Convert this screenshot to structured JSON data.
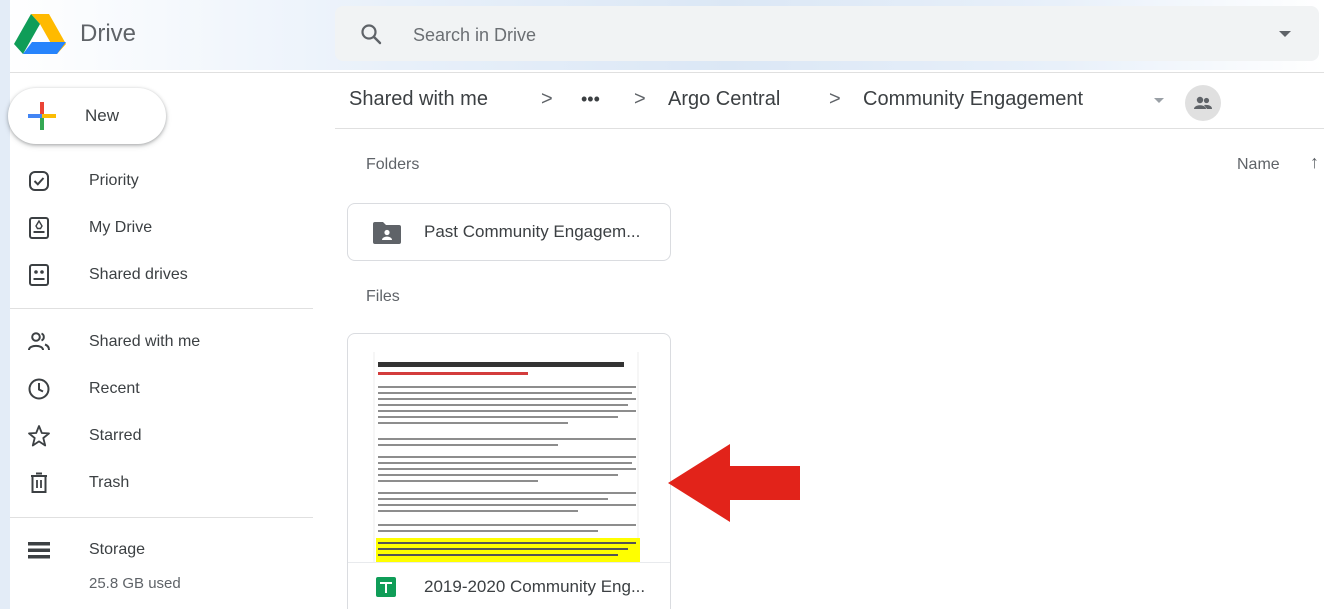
{
  "app": {
    "title": "Drive"
  },
  "search": {
    "placeholder": "Search in Drive",
    "icon": "search-icon"
  },
  "sidebar": {
    "new_label": "New",
    "items": [
      {
        "label": "Priority",
        "icon": "priority-check-icon"
      },
      {
        "label": "My Drive",
        "icon": "my-drive-icon"
      },
      {
        "label": "Shared drives",
        "icon": "shared-drives-icon"
      },
      {
        "label": "Shared with me",
        "icon": "people-icon"
      },
      {
        "label": "Recent",
        "icon": "clock-icon"
      },
      {
        "label": "Starred",
        "icon": "star-icon"
      },
      {
        "label": "Trash",
        "icon": "trash-icon"
      }
    ],
    "storage": {
      "label": "Storage",
      "used": "25.8 GB used",
      "icon": "storage-icon"
    }
  },
  "breadcrumb": {
    "items": [
      "Shared with me",
      "•••",
      "Argo Central",
      "Community Engagement"
    ],
    "separator": ">"
  },
  "content": {
    "folders_title": "Folders",
    "files_title": "Files",
    "sort_label": "Name",
    "sort_arrow": "↑",
    "folders": [
      {
        "name": "Past Community Engagem..."
      }
    ],
    "files": [
      {
        "name": "2019-2020 Community Eng..."
      }
    ]
  },
  "colors": {
    "accent_red": "#e2231a",
    "sheets_green": "#0f9d58",
    "highlight_yellow": "#ffff00"
  }
}
